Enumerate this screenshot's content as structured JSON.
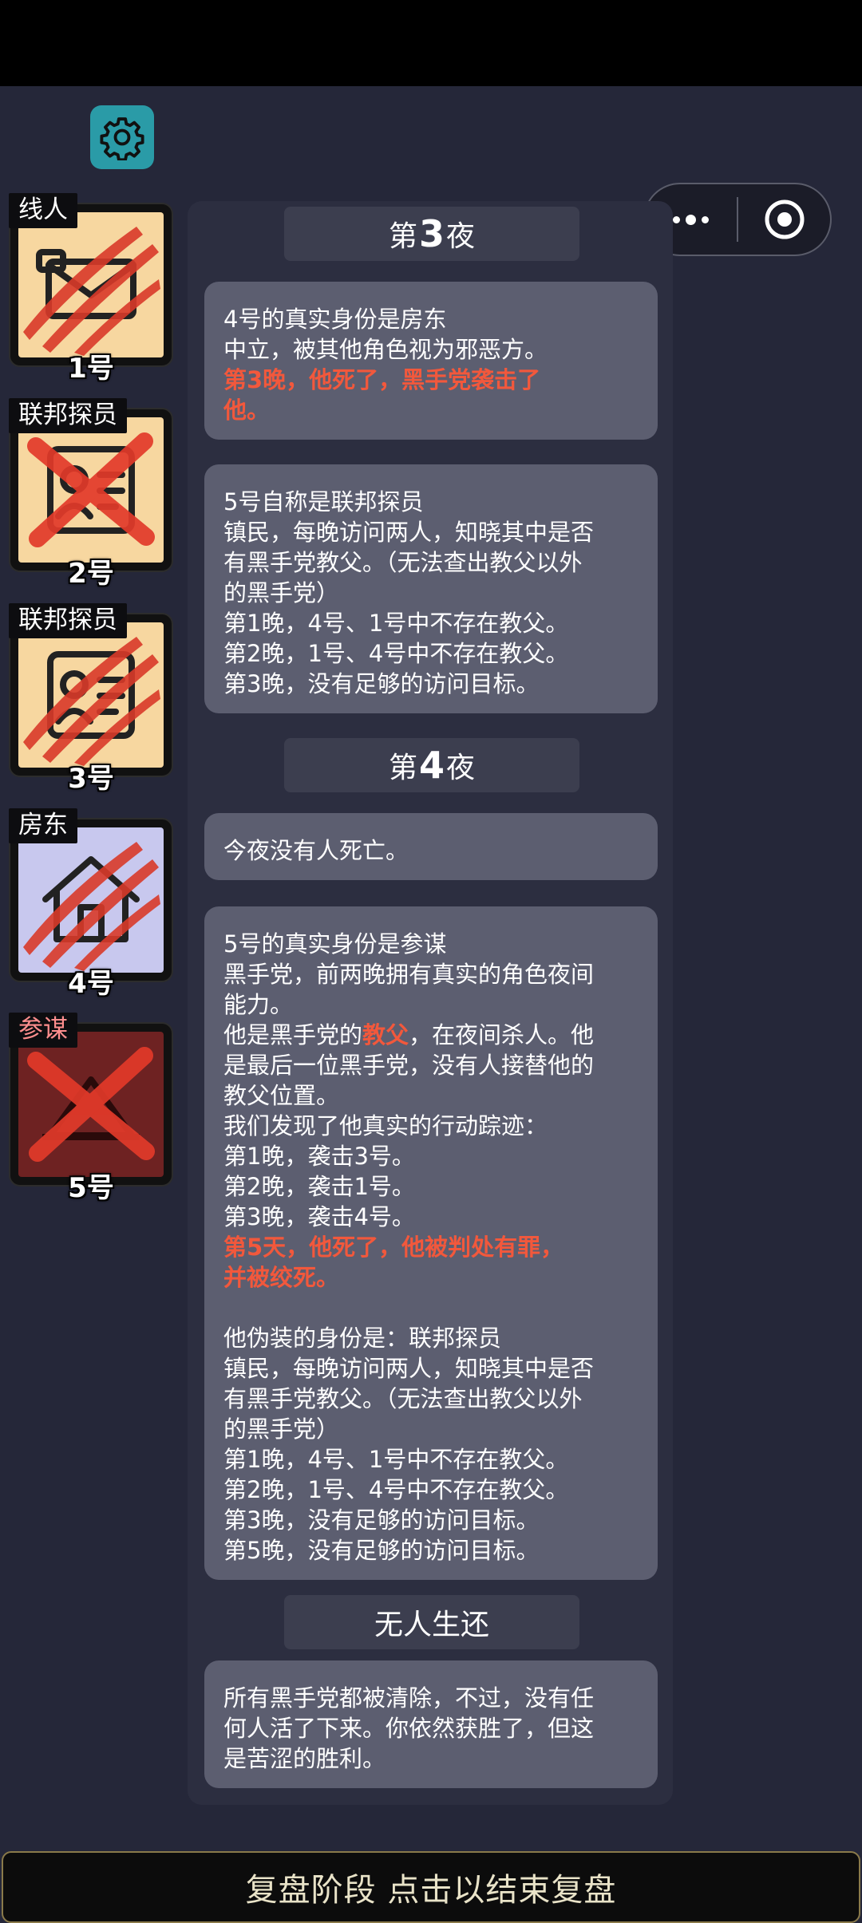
{
  "header": {
    "settings_icon": "gear-icon",
    "capsule_menu_icon": "more-dots-icon",
    "capsule_close_icon": "record-circle-icon"
  },
  "players": [
    {
      "role": "线人",
      "number": "1号",
      "status": "attacked",
      "evil": false,
      "bg": "#f7d7a0",
      "portrait": "envelope"
    },
    {
      "role": "联邦探员",
      "number": "2号",
      "status": "executed",
      "evil": false,
      "bg": "#f7d7a0",
      "portrait": "badge"
    },
    {
      "role": "联邦探员",
      "number": "3号",
      "status": "attacked",
      "evil": false,
      "bg": "#f7d7a0",
      "portrait": "badge"
    },
    {
      "role": "房东",
      "number": "4号",
      "status": "attacked",
      "evil": false,
      "bg": "#c8c8ee",
      "portrait": "house"
    },
    {
      "role": "参谋",
      "number": "5号",
      "status": "executed",
      "evil": true,
      "bg": "#6e2222",
      "portrait": "hat"
    }
  ],
  "log": {
    "night3": {
      "prefix": "第",
      "num": "3",
      "suffix": "夜"
    },
    "night3_entries": [
      {
        "lines": [
          {
            "text": "4号的真实身份是房东"
          },
          {
            "text": "中立，被其他角色视为邪恶方。"
          },
          {
            "text": "第3晚，他死了，黑手党袭击了",
            "red": true
          },
          {
            "text": "他。",
            "red": true
          }
        ]
      },
      {
        "lines": [
          {
            "text": "5号自称是联邦探员"
          },
          {
            "text": "镇民，每晚访问两人，知晓其中是否"
          },
          {
            "text": "有黑手党教父。（无法查出教父以外"
          },
          {
            "text": "的黑手党）"
          },
          {
            "text": "第1晚，4号、1号中不存在教父。"
          },
          {
            "text": "第2晚，1号、4号中不存在教父。"
          },
          {
            "text": "第3晚，没有足够的访问目标。"
          }
        ]
      }
    ],
    "night4": {
      "prefix": "第",
      "num": "4",
      "suffix": "夜"
    },
    "night4_entries": [
      {
        "lines": [
          {
            "text": "今夜没有人死亡。"
          }
        ]
      },
      {
        "lines": [
          {
            "text": "5号的真实身份是参谋"
          },
          {
            "text": "黑手党，前两晚拥有真实的角色夜间"
          },
          {
            "text": "能力。"
          },
          {
            "text": "他是黑手党的",
            "red_part": "教父",
            "after": "，在夜间杀人。他"
          },
          {
            "text": "是最后一位黑手党，没有人接替他的"
          },
          {
            "text": "教父位置。"
          },
          {
            "text": "我们发现了他真实的行动踪迹："
          },
          {
            "text": "第1晚，袭击3号。"
          },
          {
            "text": "第2晚，袭击1号。"
          },
          {
            "text": "第3晚，袭击4号。"
          },
          {
            "text": "第5天，他死了，他被判处有罪，",
            "red": true
          },
          {
            "text": "并被绞死。",
            "red": true
          },
          {
            "text": ""
          },
          {
            "text": "他伪装的身份是：联邦探员"
          },
          {
            "text": "镇民，每晚访问两人，知晓其中是否"
          },
          {
            "text": "有黑手党教父。（无法查出教父以外"
          },
          {
            "text": "的黑手党）"
          },
          {
            "text": "第1晚，4号、1号中不存在教父。"
          },
          {
            "text": "第2晚，1号、4号中不存在教父。"
          },
          {
            "text": "第3晚，没有足够的访问目标。"
          },
          {
            "text": "第5晚，没有足够的访问目标。"
          }
        ]
      }
    ],
    "ending": {
      "title": "无人生还"
    },
    "ending_entries": [
      {
        "lines": [
          {
            "text": "所有黑手党都被清除，不过，没有任"
          },
          {
            "text": "何人活了下来。你依然获胜了，但这"
          },
          {
            "text": "是苦涩的胜利。"
          }
        ]
      }
    ]
  },
  "footer": {
    "label": "复盘阶段 点击以结束复盘"
  },
  "colors": {
    "accent_red": "#f2583c",
    "settings_bg": "#2a9ba7",
    "footer_border": "#8a7a4a"
  }
}
